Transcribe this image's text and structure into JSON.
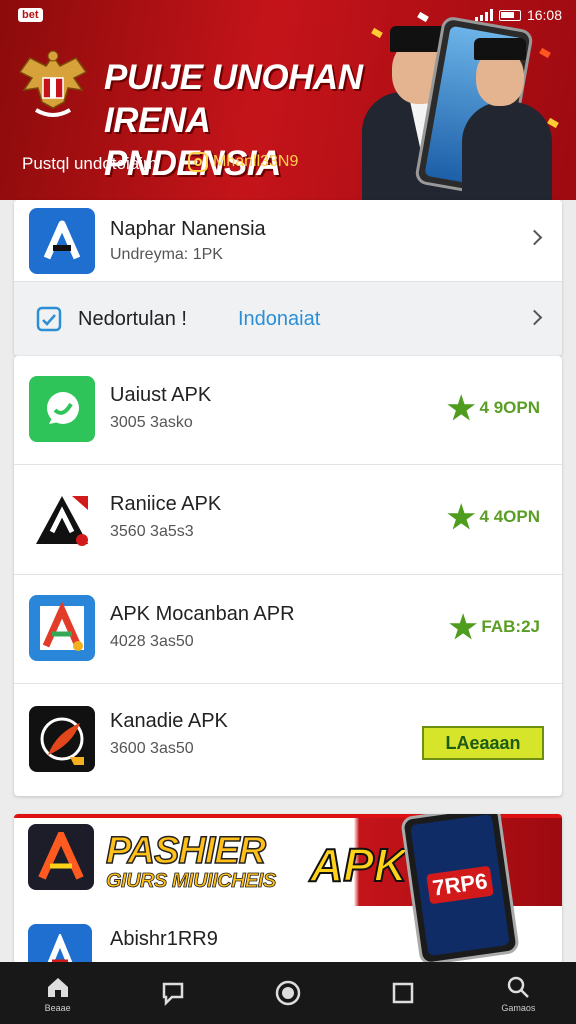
{
  "status_bar": {
    "carrier": "bet",
    "time": "16:08"
  },
  "banner": {
    "title_line1": "PUIJE UNOHAN",
    "title_line2": "IRENA PNDENSIA",
    "subtitle": "Pustql undotoiaim",
    "handle": "Mhanll33N9"
  },
  "top_card": {
    "rows": [
      {
        "title": "Naphar Nanensia",
        "meta": "Undreyma: 1PK",
        "icon": "app-a-icon"
      },
      {
        "title": "Nedortulan !",
        "highlight": "Indonaiat",
        "icon": "check-square-icon"
      }
    ]
  },
  "apps": [
    {
      "name": "Uaiust APK",
      "meta": "3005 3asko",
      "rating": "4 9OPN",
      "icon": "chat-bubble-icon",
      "color": "#2fc45a"
    },
    {
      "name": "Raniice APK",
      "meta": "3560 3a5s3",
      "rating": "4 4OPN",
      "icon": "triangle-logo-icon",
      "color": "#111111"
    },
    {
      "name": "APK Mocanban APR",
      "meta": "4028 3as50",
      "rating": "FAB:2J",
      "icon": "letter-a-icon",
      "color": "#2a86d8"
    },
    {
      "name": "Kanadie APK",
      "meta": "3600 3as50",
      "badge": "LAeaaan",
      "icon": "feather-icon",
      "color": "#111111"
    }
  ],
  "promo": {
    "title": "PASHIER",
    "subtitle": "GIURS MIUIICHEIS",
    "apk_label": "APK",
    "phone_code": "7RP6",
    "row_title": "Abishr1RR9"
  },
  "bottom_nav": [
    {
      "label": "Beaae",
      "icon": "home-icon"
    },
    {
      "label": "",
      "icon": "chat-icon"
    },
    {
      "label": "",
      "icon": "circle-home-icon"
    },
    {
      "label": "",
      "icon": "square-icon"
    },
    {
      "label": "Gamaos",
      "icon": "search-icon"
    }
  ],
  "colors": {
    "banner_red": "#c4141a",
    "rating_green": "#5a9e25",
    "highlight_blue": "#2a8fd4"
  }
}
